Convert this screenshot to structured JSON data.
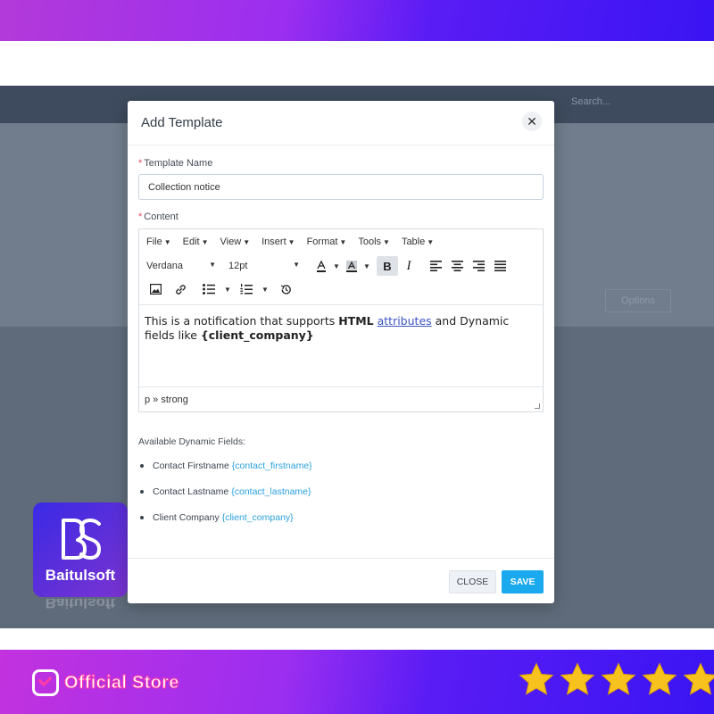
{
  "background_app": {
    "search_placeholder": "Search...",
    "options_label": "Options"
  },
  "modal": {
    "title": "Add Template",
    "close_icon": "close-icon",
    "template_name": {
      "required_mark": "*",
      "label": "Template Name",
      "value": "Collection notice"
    },
    "content": {
      "required_mark": "*",
      "label": "Content"
    },
    "editor": {
      "menus": [
        "File",
        "Edit",
        "View",
        "Insert",
        "Format",
        "Tools",
        "Table"
      ],
      "font_family": "Verdana",
      "font_size": "12pt",
      "text_before": "This is a notification that supports ",
      "bold_word": "HTML",
      "link_text": "attributes",
      "text_middle": " and Dynamic fields like ",
      "bold_field": "{client_company}",
      "status_path": "p » strong"
    },
    "dynamic_fields": {
      "title": "Available Dynamic Fields:",
      "items": [
        {
          "label": "Contact Firstname",
          "key": "{contact_firstname}"
        },
        {
          "label": "Contact Lastname",
          "key": "{contact_lastname}"
        },
        {
          "label": "Client Company",
          "key": "{client_company}"
        }
      ]
    },
    "footer": {
      "close_label": "CLOSE",
      "save_label": "SAVE"
    }
  },
  "branding": {
    "logo_monogram": "BS",
    "logo_name": "Baitulsoft",
    "store_label": "Official Store",
    "rating_stars": 5
  },
  "colors": {
    "accent_blue": "#1ba9ee",
    "link_blue": "#2aa0dc",
    "required_red": "#e74c5a",
    "star_gold": "#f7c21e",
    "band_purple": "#5a1cf5"
  }
}
